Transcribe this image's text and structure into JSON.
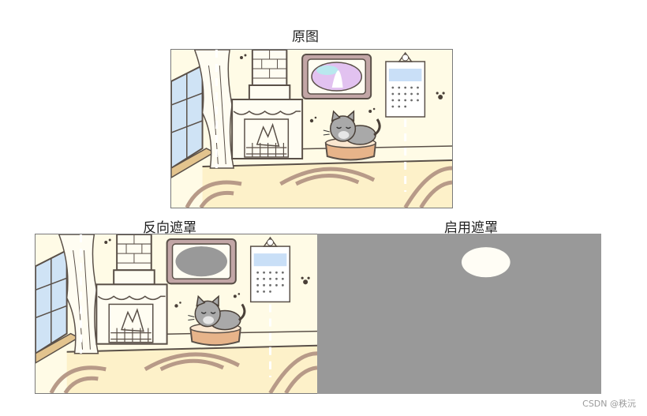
{
  "titles": {
    "original": "原图",
    "inverse_mask": "反向遮罩",
    "enable_mask": "启用遮罩"
  },
  "watermark": "CSDN @秩沅",
  "colors": {
    "mask_gray": "#999999",
    "wall": "#fffbe6",
    "floor": "#fdf1c9",
    "line": "#5a5048",
    "rug": "#b79a88",
    "bed": "#e7b48a",
    "mirror": "#e2c2f0",
    "mask_ellipse": "#fffdf5"
  }
}
